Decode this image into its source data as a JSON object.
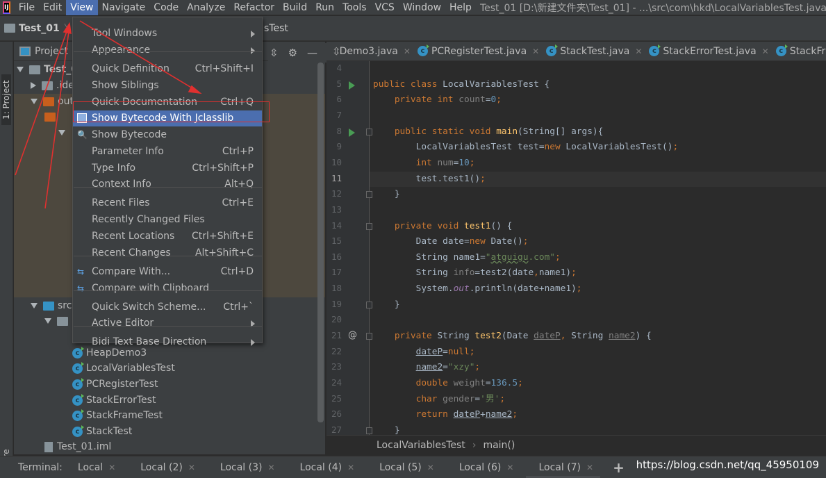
{
  "menubar": {
    "items": [
      "File",
      "Edit",
      "View",
      "Navigate",
      "Code",
      "Analyze",
      "Refactor",
      "Build",
      "Run",
      "Tools",
      "VCS",
      "Window",
      "Help"
    ],
    "active": "View",
    "title": "Test_01 [D:\\新建文件夹\\Test_01] - ...\\src\\com\\hkd\\LocalVariablesTest.java"
  },
  "navbar": {
    "project": "Test_01",
    "file_suffix": "sTest"
  },
  "leftstrip": {
    "project_label": "1: Project",
    "structure_label": "ure"
  },
  "project": {
    "header": "Project",
    "tree": [
      {
        "label": "Test_0",
        "indent": 0,
        "arrow": "down",
        "icon": "folder"
      },
      {
        "label": ".ide",
        "indent": 1,
        "arrow": "right",
        "icon": "folder"
      },
      {
        "label": "out",
        "indent": 1,
        "arrow": "down",
        "icon": "folder-brown"
      },
      {
        "label": "",
        "indent": 2,
        "arrow": "",
        "icon": "folder-brown"
      },
      {
        "label": "",
        "indent": 3,
        "arrow": "down",
        "icon": ""
      },
      {
        "label": "src",
        "indent": 1,
        "arrow": "down",
        "icon": "folder-blue"
      },
      {
        "label": "",
        "indent": 2,
        "arrow": "down",
        "icon": "package"
      },
      {
        "label": "HeapDemo3",
        "indent": 4,
        "arrow": "",
        "icon": "class"
      },
      {
        "label": "LocalVariablesTest",
        "indent": 4,
        "arrow": "",
        "icon": "class"
      },
      {
        "label": "PCRegisterTest",
        "indent": 4,
        "arrow": "",
        "icon": "class"
      },
      {
        "label": "StackErrorTest",
        "indent": 4,
        "arrow": "",
        "icon": "class"
      },
      {
        "label": "StackFrameTest",
        "indent": 4,
        "arrow": "",
        "icon": "class"
      },
      {
        "label": "StackTest",
        "indent": 4,
        "arrow": "",
        "icon": "class"
      },
      {
        "label": "Test_01.iml",
        "indent": 2,
        "arrow": "",
        "icon": "iml"
      }
    ]
  },
  "editor": {
    "tabs": [
      {
        "label": "Demo3.java"
      },
      {
        "label": "PCRegisterTest.java"
      },
      {
        "label": "StackTest.java"
      },
      {
        "label": "StackErrorTest.java"
      },
      {
        "label": "StackFrame"
      }
    ],
    "current_line": 11,
    "lines": [
      {
        "n": 4,
        "t": []
      },
      {
        "n": 5,
        "run": true,
        "t": [
          [
            "public class ",
            "kw"
          ],
          [
            "LocalVariablesTest {",
            ""
          ]
        ]
      },
      {
        "n": 6,
        "t": [
          [
            "    private int ",
            "kw"
          ],
          [
            "count",
            "gr"
          ],
          [
            "=",
            ""
          ],
          [
            "0",
            "num"
          ],
          [
            ";",
            "kw"
          ]
        ]
      },
      {
        "n": 7,
        "t": []
      },
      {
        "n": 8,
        "run": true,
        "fold": true,
        "t": [
          [
            "    public static void ",
            "kw"
          ],
          [
            "main",
            "fn"
          ],
          [
            "(String[] args){",
            ""
          ]
        ]
      },
      {
        "n": 9,
        "t": [
          [
            "        LocalVariablesTest test=",
            ""
          ],
          [
            "new ",
            "kw"
          ],
          [
            "LocalVariablesTest()",
            ""
          ],
          [
            ";",
            "kw"
          ]
        ]
      },
      {
        "n": 10,
        "t": [
          [
            "        int ",
            "kw"
          ],
          [
            "num",
            "gr"
          ],
          [
            "=",
            ""
          ],
          [
            "10",
            "num"
          ],
          [
            ";",
            "kw"
          ]
        ]
      },
      {
        "n": 11,
        "t": [
          [
            "        test.test1()",
            ""
          ],
          [
            ";",
            "kw"
          ]
        ]
      },
      {
        "n": 12,
        "fold": true,
        "t": [
          [
            "    }",
            ""
          ]
        ]
      },
      {
        "n": 13,
        "t": []
      },
      {
        "n": 14,
        "fold": true,
        "t": [
          [
            "    private void ",
            "kw"
          ],
          [
            "test1",
            "fn"
          ],
          [
            "() {",
            ""
          ]
        ]
      },
      {
        "n": 15,
        "t": [
          [
            "        Date date=",
            ""
          ],
          [
            "new ",
            "kw"
          ],
          [
            "Date()",
            ""
          ],
          [
            ";",
            "kw"
          ]
        ]
      },
      {
        "n": 16,
        "t": [
          [
            "        String name1=",
            ""
          ],
          [
            "\"",
            "str"
          ],
          [
            "atguigu",
            "strw"
          ],
          [
            ".com\"",
            "str"
          ],
          [
            ";",
            "kw"
          ]
        ]
      },
      {
        "n": 17,
        "t": [
          [
            "        String ",
            ""
          ],
          [
            "info",
            "gr"
          ],
          [
            "=test2(date",
            ""
          ],
          [
            ",",
            "kw"
          ],
          [
            "name1)",
            ""
          ],
          [
            ";",
            "kw"
          ]
        ]
      },
      {
        "n": 18,
        "t": [
          [
            "        System.",
            ""
          ],
          [
            "out",
            "fld"
          ],
          [
            ".println(date+name1)",
            ""
          ],
          [
            ";",
            "kw"
          ]
        ]
      },
      {
        "n": 19,
        "fold": true,
        "t": [
          [
            "    }",
            ""
          ]
        ]
      },
      {
        "n": 20,
        "t": []
      },
      {
        "n": 21,
        "at": true,
        "fold": true,
        "t": [
          [
            "    private ",
            "kw"
          ],
          [
            "String ",
            ""
          ],
          [
            "test2",
            "fn"
          ],
          [
            "(Date ",
            ""
          ],
          [
            "dateP",
            "par gr"
          ],
          [
            ", ",
            "kw"
          ],
          [
            "String ",
            ""
          ],
          [
            "name2",
            "par gr"
          ],
          [
            ") {",
            ""
          ]
        ]
      },
      {
        "n": 22,
        "t": [
          [
            "        ",
            ""
          ],
          [
            "dateP",
            "par"
          ],
          [
            "=",
            ""
          ],
          [
            "null",
            "kw"
          ],
          [
            ";",
            "kw"
          ]
        ]
      },
      {
        "n": 23,
        "t": [
          [
            "        ",
            ""
          ],
          [
            "name2",
            "par"
          ],
          [
            "=",
            ""
          ],
          [
            "\"xzy\"",
            "str"
          ],
          [
            ";",
            "kw"
          ]
        ]
      },
      {
        "n": 24,
        "t": [
          [
            "        double ",
            "kw"
          ],
          [
            "weight",
            "gr"
          ],
          [
            "=",
            ""
          ],
          [
            "136.5",
            "num"
          ],
          [
            ";",
            "kw"
          ]
        ]
      },
      {
        "n": 25,
        "t": [
          [
            "        char ",
            "kw"
          ],
          [
            "gender",
            "gr"
          ],
          [
            "=",
            ""
          ],
          [
            "'男'",
            "str"
          ],
          [
            ";",
            "kw"
          ]
        ]
      },
      {
        "n": 26,
        "t": [
          [
            "        return ",
            "kw"
          ],
          [
            "dateP",
            "par"
          ],
          [
            "+",
            ""
          ],
          [
            "name2",
            "par"
          ],
          [
            ";",
            "kw"
          ]
        ]
      },
      {
        "n": 27,
        "fold": true,
        "t": [
          [
            "    }",
            ""
          ]
        ]
      }
    ],
    "breadcrumb": [
      "LocalVariablesTest",
      "main()"
    ]
  },
  "view_menu": {
    "items": [
      {
        "label": "Tool Windows",
        "submenu": true
      },
      {
        "label": "Appearance",
        "submenu": true
      },
      {
        "sep": true
      },
      {
        "label": "Quick Definition",
        "shortcut": "Ctrl+Shift+I"
      },
      {
        "label": "Show Siblings"
      },
      {
        "label": "Quick Documentation",
        "shortcut": "Ctrl+Q"
      },
      {
        "label": "Show Bytecode With Jclasslib",
        "highlighted": true,
        "icon": "jclasslib"
      },
      {
        "label": "Show Bytecode",
        "icon": "bytecode"
      },
      {
        "label": "Parameter Info",
        "shortcut": "Ctrl+P"
      },
      {
        "label": "Type Info",
        "shortcut": "Ctrl+Shift+P"
      },
      {
        "label": "Context Info",
        "shortcut": "Alt+Q"
      },
      {
        "sep": true
      },
      {
        "label": "Recent Files",
        "shortcut": "Ctrl+E"
      },
      {
        "label": "Recently Changed Files"
      },
      {
        "label": "Recent Locations",
        "shortcut": "Ctrl+Shift+E"
      },
      {
        "label": "Recent Changes",
        "shortcut": "Alt+Shift+C"
      },
      {
        "sep": true
      },
      {
        "label": "Compare With...",
        "shortcut": "Ctrl+D",
        "icon": "compare"
      },
      {
        "label": "Compare with Clipboard",
        "icon": "compare-clipboard"
      },
      {
        "sep": true
      },
      {
        "label": "Quick Switch Scheme...",
        "shortcut": "Ctrl+`"
      },
      {
        "label": "Active Editor",
        "submenu": true
      },
      {
        "sep": true
      },
      {
        "label": "Bidi Text Base Direction",
        "submenu": true
      }
    ]
  },
  "terminal": {
    "label": "Terminal:",
    "tabs": [
      "Local",
      "Local (2)",
      "Local (3)",
      "Local (4)",
      "Local (5)",
      "Local (6)",
      "Local (7)"
    ],
    "selected": "Local (7)",
    "add": "+"
  },
  "watermark": "https://blog.csdn.net/qq_45950109",
  "colors": {
    "accent": "#4b6eaf",
    "annotation": "#e0302f",
    "keyword": "#cc7832",
    "string": "#6a8759",
    "number": "#6897bb",
    "function": "#ffc66d"
  }
}
